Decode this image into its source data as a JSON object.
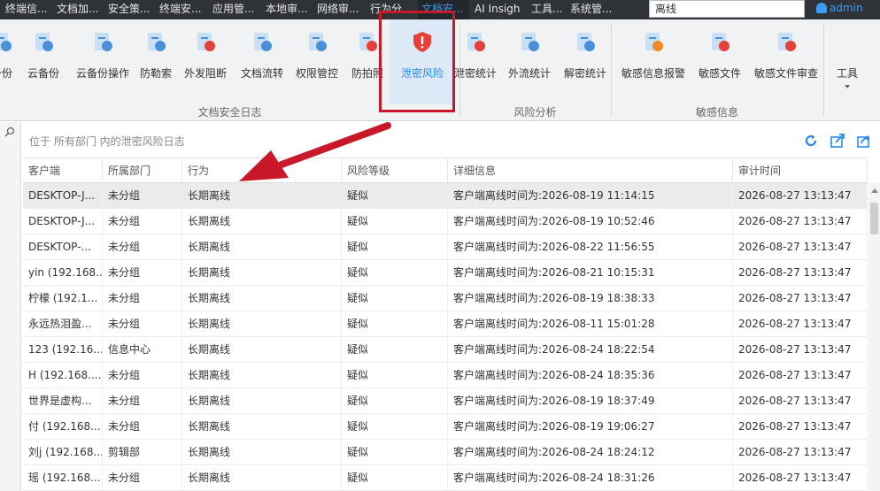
{
  "top_tabs": [
    "终端信...",
    "文档加...",
    "安全策...",
    "终端安...",
    "应用管...",
    "本地审...",
    "网络审...",
    "行为分...",
    "文档安...",
    "AI Insigh",
    "工具...",
    "系统管..."
  ],
  "active_tab_index": 8,
  "search": {
    "value": "离线"
  },
  "user": {
    "name": "admin"
  },
  "ribbon": {
    "buttons": [
      "备份",
      "云备份",
      "云备份操作",
      "防勒索",
      "外发阻断",
      "文档流转",
      "权限管控",
      "防拍照",
      "泄密风险",
      "泄密统计",
      "外流统计",
      "解密统计",
      "敏感信息报警",
      "敏感文件",
      "敏感文件审查",
      "工具"
    ],
    "selected_index": 8,
    "groups": [
      "文档安全日志",
      "风险分析",
      "敏感信息"
    ]
  },
  "info": {
    "text": "位于 所有部门 内的泄密风险日志"
  },
  "icons": {
    "refresh": "refresh-icon",
    "export": "export-icon",
    "share": "share-icon",
    "search": "search-icon"
  },
  "colors": {
    "accent": "#2a8ae8",
    "danger": "#e5403a",
    "highlight": "#c8182a"
  },
  "table": {
    "columns": [
      "客户端",
      "所属部门",
      "行为",
      "风险等级",
      "详细信息",
      "审计时间"
    ],
    "rows": [
      [
        "DESKTOP-J...",
        "未分组",
        "长期离线",
        "疑似",
        "客户端离线时间为:2026-08-19 11:14:15",
        "2026-08-27 13:13:47"
      ],
      [
        "DESKTOP-J...",
        "未分组",
        "长期离线",
        "疑似",
        "客户端离线时间为:2026-08-19 10:52:46",
        "2026-08-27 13:13:47"
      ],
      [
        "DESKTOP-...",
        "未分组",
        "长期离线",
        "疑似",
        "客户端离线时间为:2026-08-22 11:56:55",
        "2026-08-27 13:13:47"
      ],
      [
        "yin (192.168...",
        "未分组",
        "长期离线",
        "疑似",
        "客户端离线时间为:2026-08-21 10:15:31",
        "2026-08-27 13:13:47"
      ],
      [
        "柠檬 (192.1...",
        "未分组",
        "长期离线",
        "疑似",
        "客户端离线时间为:2026-08-19 18:38:33",
        "2026-08-27 13:13:47"
      ],
      [
        "永远热泪盈...",
        "未分组",
        "长期离线",
        "疑似",
        "客户端离线时间为:2026-08-11 15:01:28",
        "2026-08-27 13:13:47"
      ],
      [
        "123 (192.16...",
        "信息中心",
        "长期离线",
        "疑似",
        "客户端离线时间为:2026-08-24 18:22:54",
        "2026-08-27 13:13:47"
      ],
      [
        "H (192.168....",
        "未分组",
        "长期离线",
        "疑似",
        "客户端离线时间为:2026-08-24 18:35:36",
        "2026-08-27 13:13:47"
      ],
      [
        "世界是虚构...",
        "未分组",
        "长期离线",
        "疑似",
        "客户端离线时间为:2026-08-19 18:37:49",
        "2026-08-27 13:13:47"
      ],
      [
        "付 (192.168....",
        "未分组",
        "长期离线",
        "疑似",
        "客户端离线时间为:2026-08-19 19:06:27",
        "2026-08-27 13:13:47"
      ],
      [
        "刘j (192.168....",
        "剪辑部",
        "长期离线",
        "疑似",
        "客户端离线时间为:2026-08-24 18:24:12",
        "2026-08-27 13:13:47"
      ],
      [
        "瑶 (192.168....",
        "未分组",
        "长期离线",
        "疑似",
        "客户端离线时间为:2026-08-24 18:31:26",
        "2026-08-27 13:13:47"
      ]
    ]
  }
}
